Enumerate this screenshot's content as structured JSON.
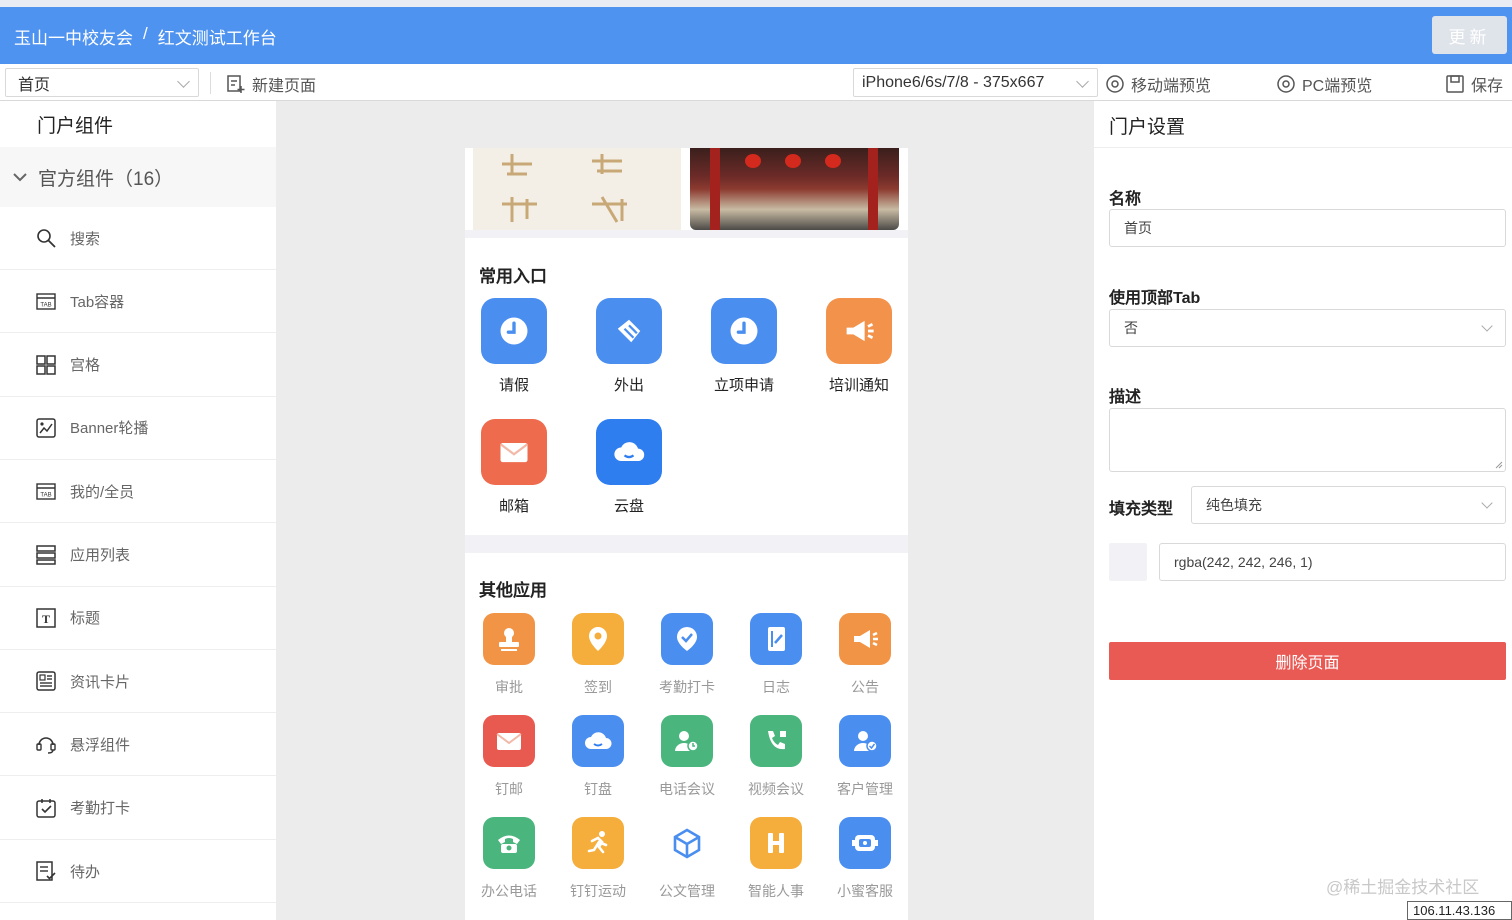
{
  "header": {
    "app": "玉山一中校友会",
    "separator": "/",
    "workbench": "红文测试工作台",
    "update_label": "更新"
  },
  "toolbar": {
    "page_select": "首页",
    "new_page": "新建页面",
    "device_select": "iPhone6/6s/7/8 - 375x667",
    "mobile_preview": "移动端预览",
    "pc_preview": "PC端预览",
    "save": "保存"
  },
  "left": {
    "title": "门户组件",
    "group": "官方组件（16）",
    "items": [
      "搜索",
      "Tab容器",
      "宫格",
      "Banner轮播",
      "我的/全员",
      "应用列表",
      "标题",
      "资讯卡片",
      "悬浮组件",
      "考勤打卡",
      "待办"
    ]
  },
  "phone": {
    "banner_text": "",
    "common_title": "常用入口",
    "common_apps": [
      {
        "label": "请假",
        "icon": "clock-icon",
        "color": "#4a8ef0"
      },
      {
        "label": "外出",
        "icon": "tag-icon",
        "color": "#4a8ef0"
      },
      {
        "label": "立项申请",
        "icon": "clock-icon",
        "color": "#4a8ef0"
      },
      {
        "label": "培训通知",
        "icon": "megaphone-icon",
        "color": "#f3924a"
      },
      {
        "label": "邮箱",
        "icon": "mail-icon",
        "color": "#ee6c4d"
      },
      {
        "label": "云盘",
        "icon": "cloud-icon",
        "color": "#2f7ef0"
      }
    ],
    "other_title": "其他应用",
    "other_apps": [
      {
        "label": "审批",
        "icon": "stamp-icon",
        "color": "#f29446"
      },
      {
        "label": "签到",
        "icon": "location-icon",
        "color": "#f5ad3b"
      },
      {
        "label": "考勤打卡",
        "icon": "checkin-icon",
        "color": "#4a8ef0"
      },
      {
        "label": "日志",
        "icon": "notebook-icon",
        "color": "#4a8ef0"
      },
      {
        "label": "公告",
        "icon": "megaphone-icon",
        "color": "#f29446"
      },
      {
        "label": "钉邮",
        "icon": "mail-icon",
        "color": "#e85a4f"
      },
      {
        "label": "钉盘",
        "icon": "cloud-icon",
        "color": "#4a8ef0"
      },
      {
        "label": "电话会议",
        "icon": "conference-icon",
        "color": "#4bb57e"
      },
      {
        "label": "视频会议",
        "icon": "video-call-icon",
        "color": "#4bb57e"
      },
      {
        "label": "客户管理",
        "icon": "customer-icon",
        "color": "#4a8ef0"
      },
      {
        "label": "办公电话",
        "icon": "phone-icon",
        "color": "#4bb57e"
      },
      {
        "label": "钉钉运动",
        "icon": "run-icon",
        "color": "#f5ad3b"
      },
      {
        "label": "公文管理",
        "icon": "cube-icon",
        "color": "#4a8ef0"
      },
      {
        "label": "智能人事",
        "icon": "hr-icon",
        "color": "#f5ad3b"
      },
      {
        "label": "小蜜客服",
        "icon": "robot-icon",
        "color": "#4a8ef0"
      }
    ]
  },
  "settings": {
    "title": "门户设置",
    "name_label": "名称",
    "name_value": "首页",
    "toptab_label": "使用顶部Tab",
    "toptab_value": "否",
    "desc_label": "描述",
    "desc_value": "",
    "fill_label": "填充类型",
    "fill_value": "纯色填充",
    "color_value": "rgba(242, 242, 246, 1)",
    "swatch_color": "#f2f2f6",
    "delete_label": "删除页面"
  },
  "watermark": "@稀土掘金技术社区",
  "ip": "106.11.43.136"
}
